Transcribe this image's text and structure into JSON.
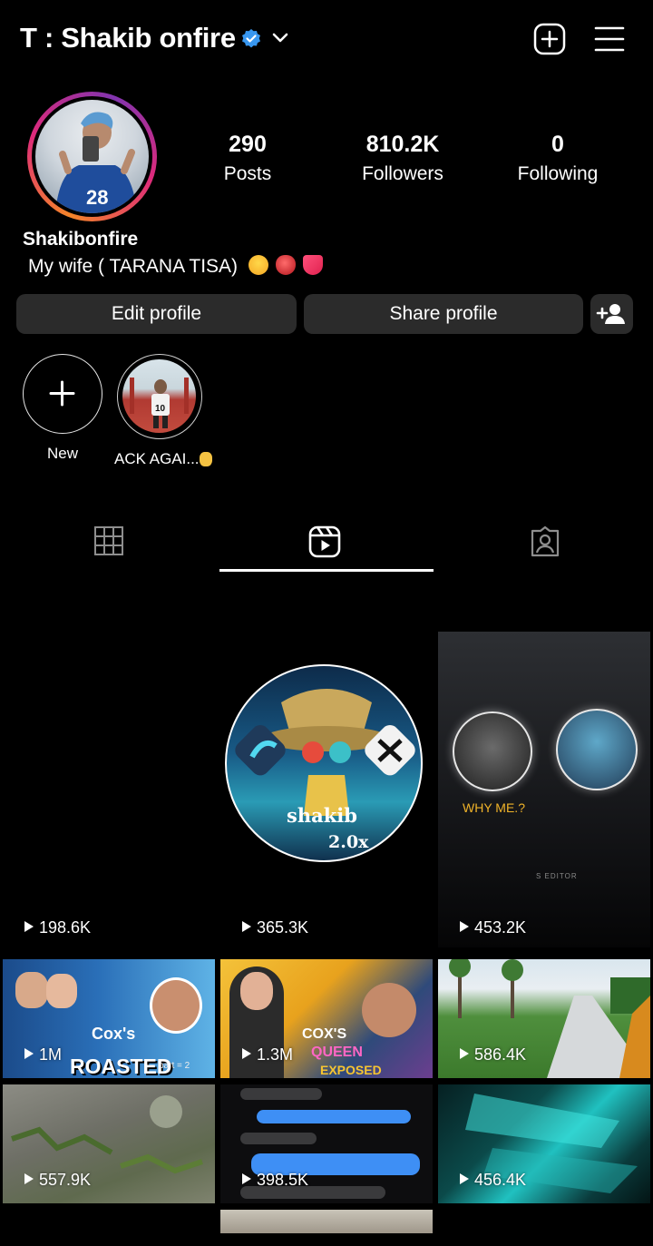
{
  "header": {
    "username": "T : Shakib onfire",
    "icons": [
      "verified-badge-icon",
      "chevron-down-icon",
      "add-post-icon",
      "menu-icon"
    ]
  },
  "profile": {
    "display_name": "Shakibonfire",
    "bio": "My wife ( TARANA TISA)",
    "stats": [
      {
        "value": "290",
        "label": "Posts"
      },
      {
        "value": "810.2K",
        "label": "Followers"
      },
      {
        "value": "0",
        "label": "Following"
      }
    ]
  },
  "buttons": {
    "edit": "Edit profile",
    "share": "Share profile"
  },
  "highlights": [
    {
      "label": "New"
    },
    {
      "label": "ACK AGAI..."
    }
  ],
  "tabs": [
    "grid-icon",
    "reels-icon",
    "tagged-icon"
  ],
  "reels": [
    {
      "views": "198.6K"
    },
    {
      "views": "365.3K",
      "overlay": "shakib",
      "overlay2": "2.0x"
    },
    {
      "views": "453.2K",
      "overlay": "WHY ME.?",
      "caption": "S EDITOR"
    },
    {
      "views": "1M",
      "overlay": "Cox's",
      "overlay2": "ROASTED",
      "part": "part = 2"
    },
    {
      "views": "1.3M",
      "overlay": "COX'S",
      "overlay2": "QUEEN",
      "overlay3": "EXPOSED"
    },
    {
      "views": "586.4K"
    },
    {
      "views": "557.9K"
    },
    {
      "views": "398.5K"
    },
    {
      "views": "456.4K"
    }
  ],
  "colors": {
    "accent": "#3897f0",
    "button_bg": "#2b2b2b",
    "background": "#000000"
  }
}
